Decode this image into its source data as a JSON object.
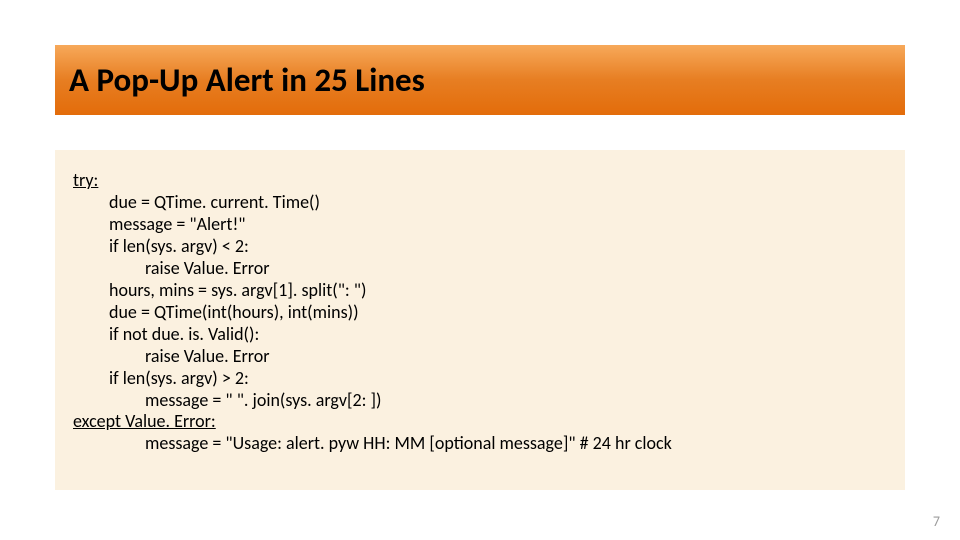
{
  "title": "A Pop-Up Alert in 25 Lines",
  "page_number": "7",
  "code": {
    "try_kw": "try:",
    "l1": "due = QTime. current. Time()",
    "l2": "message = \"Alert!\"",
    "l3": "if len(sys. argv) < 2:",
    "l4": "raise Value. Error",
    "l5": "hours, mins = sys. argv[1]. split(\": \")",
    "l6": "due = QTime(int(hours), int(mins))",
    "l7": "if not due. is. Valid():",
    "l8": "raise Value. Error",
    "l9": "if len(sys. argv) > 2:",
    "l10": "message = \" \". join(sys. argv[2: ])",
    "except_kw": "except Value. Error:",
    "l11": "message = \"Usage: alert. pyw HH: MM [optional message]\" # 24 hr clock"
  }
}
